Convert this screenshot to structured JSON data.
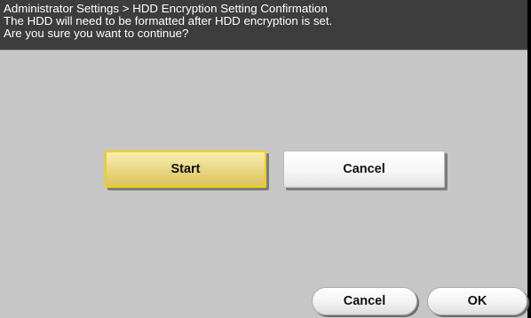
{
  "header": {
    "line1": "Administrator Settings > HDD Encryption Setting Confirmation",
    "line2": "The HDD will need to be formatted after HDD encryption is set.",
    "line3": "Are you sure you want to continue?"
  },
  "dialog": {
    "start_label": "Start",
    "cancel_label": "Cancel"
  },
  "footer": {
    "cancel_label": "Cancel",
    "ok_label": "OK"
  },
  "colors": {
    "header_bg": "#3d3d3d",
    "panel_bg": "#c6c6c6",
    "selected_border": "#f0d000"
  }
}
